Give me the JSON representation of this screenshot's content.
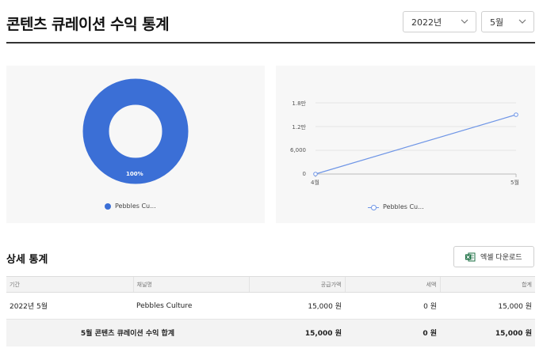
{
  "header": {
    "title": "콘텐츠 큐레이션 수익 통계",
    "year_select": "2022년",
    "month_select": "5월"
  },
  "donut": {
    "percent_label": "100%",
    "legend": "Pebbles Cu...",
    "color": "#3b6fd6"
  },
  "chart_data": {
    "type": "line",
    "x": [
      "4월",
      "5월"
    ],
    "series": [
      {
        "name": "Pebbles Cu...",
        "values": [
          0,
          15000
        ]
      }
    ],
    "yticks": [
      "1.8만",
      "1.2만",
      "6,000",
      "0"
    ],
    "ylim": [
      0,
      18000
    ],
    "legend_placement": "bottom",
    "color": "#6e95e6"
  },
  "details": {
    "title": "상세 통계",
    "excel_button": "엑셀 다운로드",
    "columns": {
      "period": "기간",
      "channel": "채널명",
      "supply": "공급가액",
      "tax": "세액",
      "total": "합계"
    },
    "row": {
      "period": "2022년 5월",
      "channel": "Pebbles Culture",
      "supply": "15,000 원",
      "tax": "0 원",
      "total": "15,000 원"
    },
    "total_row": {
      "label": "5월 콘텐츠 큐레이션 수익 합계",
      "supply": "15,000 원",
      "tax": "0 원",
      "total": "15,000 원"
    }
  }
}
